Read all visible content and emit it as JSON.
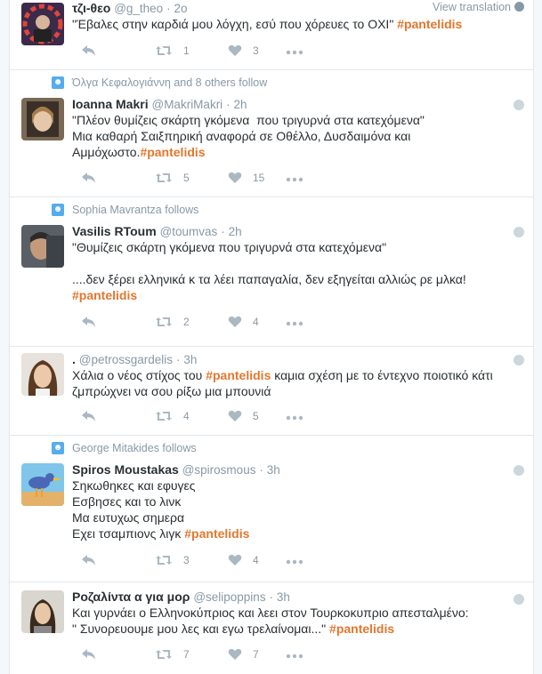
{
  "colors": {
    "accent": "#e4762d",
    "muted": "#8899a6",
    "follow_icon": "#55acee"
  },
  "tweets": [
    {
      "context": "",
      "name": "τζι-θεο",
      "handle": "@g_theo",
      "dot": "·",
      "time": "2ο",
      "translate": "View translation",
      "text_before": "\"Έβαλες στην καρδιά μου λόγχη, εσύ που χόρευες το ΟΧΙ\" ",
      "hashtag": "#pantelidis",
      "text_after": "",
      "retweets": "1",
      "likes": "3"
    },
    {
      "context": "Όλγα Κεφαλογιάννη and 8 others follow",
      "name": "Ioanna Makri",
      "handle": "@MakriMakri",
      "dot": "·",
      "time": "2h",
      "text_before": "\"Πλέον θυμίζεις σκάρτη γκόμενα  που τριγυρνά στα κατεχόμενα\"\nΜια καθαρή Σαιξπηρική αναφορά σε Οθέλλο, Δυσδαιμόνα και Αμμόχωστο.",
      "hashtag": "#pantelidis",
      "text_after": "",
      "retweets": "5",
      "likes": "15"
    },
    {
      "context": "Sophia Mavrantza follows",
      "name": "Vasilis RToum",
      "handle": "@toumvas",
      "dot": "·",
      "time": "2h",
      "text_before": "\"Θυμίζεις σκάρτη γκόμενα που τριγυρνά στα κατεχόμενα\"\n\n....δεν ξέρει ελληνικά κ τα λέει παπαγαλία, δεν εξηγείται αλλιώς ρε μλκα!\n",
      "hashtag": "#pantelidis",
      "text_after": "",
      "retweets": "2",
      "likes": "4"
    },
    {
      "context": "",
      "name": ".",
      "handle": "@petrossgardelis",
      "dot": "·",
      "time": "3h",
      "text_before": "Χάλια ο νέος στίχος του ",
      "hashtag": "#pantelidis",
      "text_after": " καμια σχέση με το έντεχνο ποιοτικό κάτι ζμπρώχνει να σου ρίξω μια μπουνιά",
      "retweets": "4",
      "likes": "5"
    },
    {
      "context": "George Mitakides follows",
      "name": "Spiros Moustakas",
      "handle": "@spirosmous",
      "dot": "·",
      "time": "3h",
      "text_before": "Σηκωθηκες και εφυγες\nΕσβησες και το λινκ\nΜα ευτυχως σημερα\nΕχει τσαμπιονς λιγκ ",
      "hashtag": "#pantelidis",
      "text_after": "",
      "retweets": "3",
      "likes": "4"
    },
    {
      "context": "",
      "name": "Ροζαλίντα α για μορ",
      "handle": "@selipoppins",
      "dot": "·",
      "time": "3h",
      "text_before": "Και γυρνάει ο Ελληνοκύπριος και λεει στον Τουρκοκυπριο απεσταλμένο:\n\" Συνορευουμε μου λες και εγω τρελαίνομαι...\" ",
      "hashtag": "#pantelidis",
      "text_after": "",
      "retweets": "7",
      "likes": "7"
    }
  ]
}
